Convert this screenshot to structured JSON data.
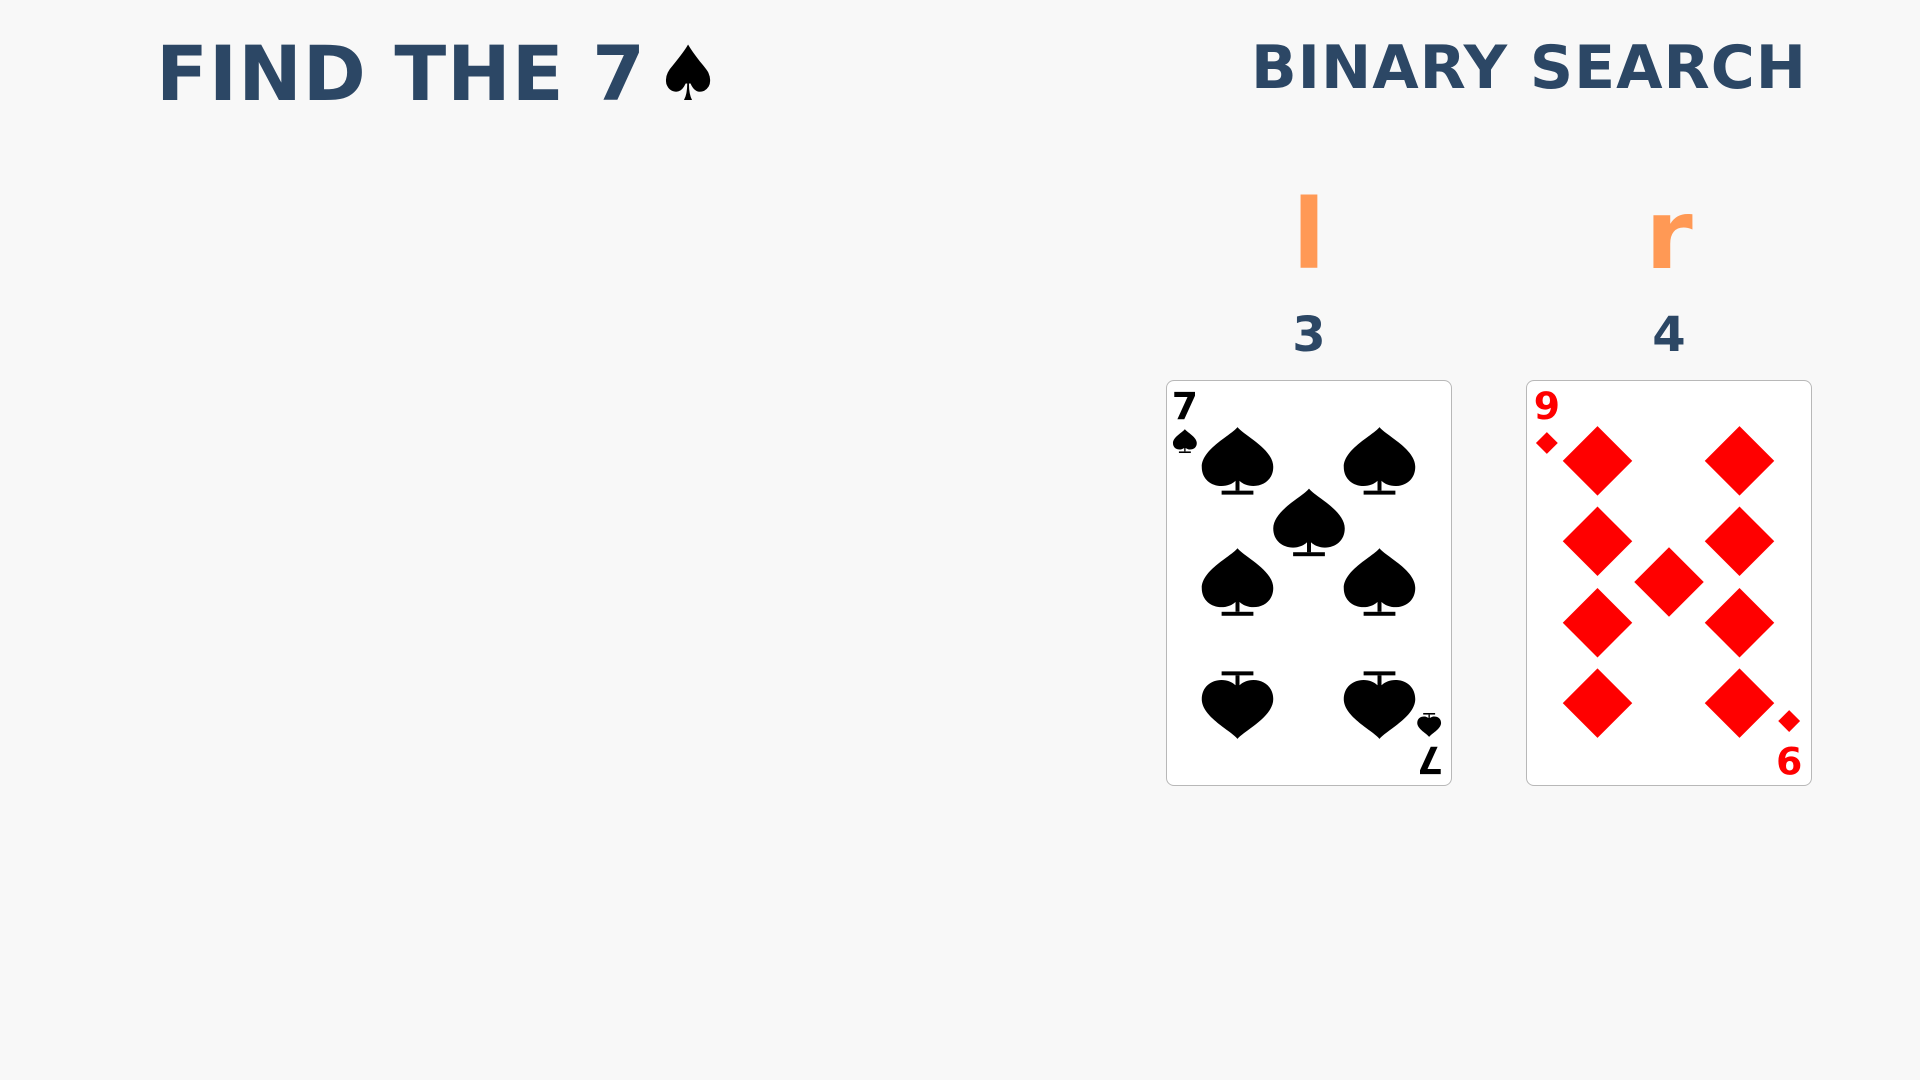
{
  "header": {
    "title": "FIND THE 7",
    "title_suit": "♠",
    "subtitle": "BINARY SEARCH"
  },
  "pointers": [
    {
      "label": "l",
      "index": "3"
    },
    {
      "label": "r",
      "index": "4"
    }
  ],
  "cards": [
    {
      "rank": "7",
      "suit": "spades",
      "suit_glyph": "♠",
      "color": "#000000"
    },
    {
      "rank": "9",
      "suit": "diamonds",
      "suit_glyph": "♦",
      "color": "#ff0000"
    }
  ],
  "colors": {
    "background": "#f8f8f8",
    "heading": "#2c4765",
    "pointer": "#ff9955",
    "spade": "#000000",
    "diamond": "#ff0000"
  }
}
